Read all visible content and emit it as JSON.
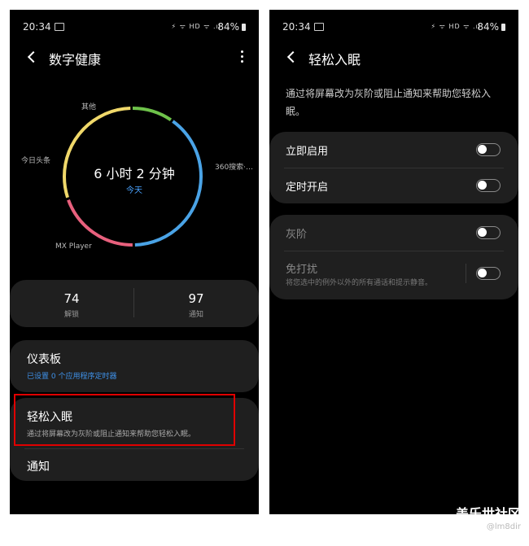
{
  "left": {
    "status": {
      "time": "20:34",
      "icons": "⚡ ᯤ HD ᯤ .ıl",
      "battery": "84%"
    },
    "header": {
      "title": "数字健康"
    },
    "usage": {
      "total": "6 小时 2 分钟",
      "subtitle": "今天",
      "apps": [
        {
          "name": "其他",
          "fraction": 0.1,
          "color": "#6ec24a"
        },
        {
          "name": "360搜索·…",
          "fraction": 0.4,
          "color": "#4aa3e6"
        },
        {
          "name": "MX Player",
          "fraction": 0.2,
          "color": "#e8607d"
        },
        {
          "name": "今日头条",
          "fraction": 0.3,
          "color": "#f0d86a"
        }
      ]
    },
    "stats": [
      {
        "value": "74",
        "label": "解锁"
      },
      {
        "value": "97",
        "label": "通知"
      }
    ],
    "dashboard": {
      "title": "仪表板",
      "subtitle": "已设置 0 个应用程序定时器",
      "subtitle_color": "#3f92ea"
    },
    "wind_down": {
      "title": "轻松入眠",
      "subtitle": "通过将屏幕改为灰阶或阻止通知来帮助您轻松入眠。"
    },
    "notifications": {
      "title": "通知"
    }
  },
  "right": {
    "status": {
      "time": "20:34",
      "icons": "⚡ ᯤ HD ᯤ .ıl",
      "battery": "84%"
    },
    "header": {
      "title": "轻松入眠"
    },
    "description": "通过将屏幕改为灰阶或阻止通知来帮助您轻松入眠。",
    "group1": [
      {
        "label": "立即启用",
        "on": false
      },
      {
        "label": "定时开启",
        "on": false
      }
    ],
    "group2": {
      "grayscale": {
        "label": "灰阶",
        "on": false
      },
      "dnd": {
        "label": "免打扰",
        "sub": "将您选中的例外以外的所有通话和提示静音。",
        "on": false
      }
    }
  },
  "watermark": {
    "main": "盖乐世社区",
    "sub": "@lm8dir"
  }
}
